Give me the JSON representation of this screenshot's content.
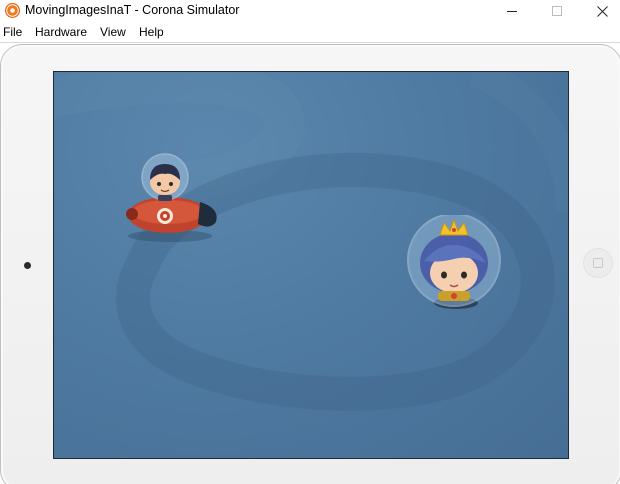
{
  "window": {
    "title": "MovingImagesInaT - Corona Simulator",
    "app_icon": "corona-logo-icon"
  },
  "menu": {
    "items": [
      "File",
      "Hardware",
      "View",
      "Help"
    ]
  },
  "controls": {
    "minimize_icon": "minimize-icon",
    "maximize_icon": "maximize-icon",
    "close_icon": "close-icon"
  },
  "simulator": {
    "device": "tablet-landscape",
    "screen_color": "#4f7aa1",
    "sprites": [
      "astronaut-boy-on-rocket",
      "astronaut-queen-with-crown"
    ]
  }
}
